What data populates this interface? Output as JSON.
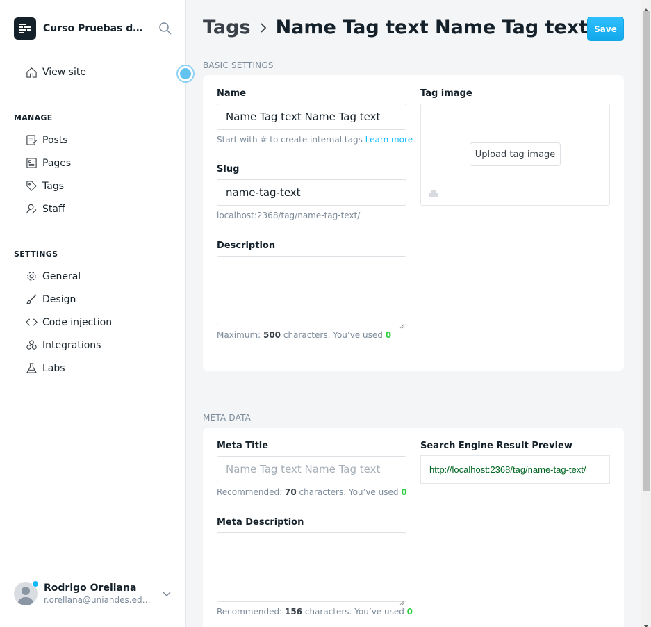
{
  "sidebar": {
    "site_name": "Curso Pruebas de Software",
    "view_site": "View site",
    "manage_heading": "MANAGE",
    "manage_items": [
      {
        "label": "Posts",
        "icon": "posts-icon"
      },
      {
        "label": "Pages",
        "icon": "pages-icon"
      },
      {
        "label": "Tags",
        "icon": "tag-icon"
      },
      {
        "label": "Staff",
        "icon": "staff-icon"
      }
    ],
    "settings_heading": "SETTINGS",
    "settings_items": [
      {
        "label": "General",
        "icon": "gear-icon"
      },
      {
        "label": "Design",
        "icon": "brush-icon"
      },
      {
        "label": "Code injection",
        "icon": "code-icon"
      },
      {
        "label": "Integrations",
        "icon": "integrations-icon"
      },
      {
        "label": "Labs",
        "icon": "flask-icon"
      }
    ],
    "user": {
      "name": "Rodrigo Orellana",
      "email": "r.orellana@uniandes.edu.co"
    }
  },
  "header": {
    "breadcrumb": "Tags",
    "title": "Name Tag text Name Tag text",
    "save_label": "Save"
  },
  "basic": {
    "section_label": "BASIC SETTINGS",
    "name_label": "Name",
    "name_value": "Name Tag text Name Tag text",
    "name_help": "Start with # to create internal tags ",
    "name_help_link": "Learn more",
    "slug_label": "Slug",
    "slug_value": "name-tag-text",
    "slug_url": "localhost:2368/tag/name-tag-text/",
    "description_label": "Description",
    "description_value": "",
    "desc_help_prefix": "Maximum: ",
    "desc_help_max": "500",
    "desc_help_mid": " characters. You’ve used ",
    "desc_help_used": "0",
    "image_label": "Tag image",
    "upload_label": "Upload tag image"
  },
  "meta": {
    "section_label": "META DATA",
    "title_label": "Meta Title",
    "title_placeholder": "Name Tag text Name Tag text",
    "title_help_prefix": "Recommended: ",
    "title_help_rec": "70",
    "title_help_mid": " characters. You’ve used ",
    "title_help_used": "0",
    "serp_label": "Search Engine Result Preview",
    "serp_url": "http://localhost:2368/tag/name-tag-text/",
    "description_label": "Meta Description",
    "desc_help_prefix": "Recommended: ",
    "desc_help_rec": "156",
    "desc_help_mid": " characters. You’ve used ",
    "desc_help_used": "0"
  },
  "colors": {
    "accent": "#14b8ff",
    "success": "#30cf43",
    "text": "#15212a",
    "muted": "#7c8b9a",
    "serp_url": "#006621"
  }
}
